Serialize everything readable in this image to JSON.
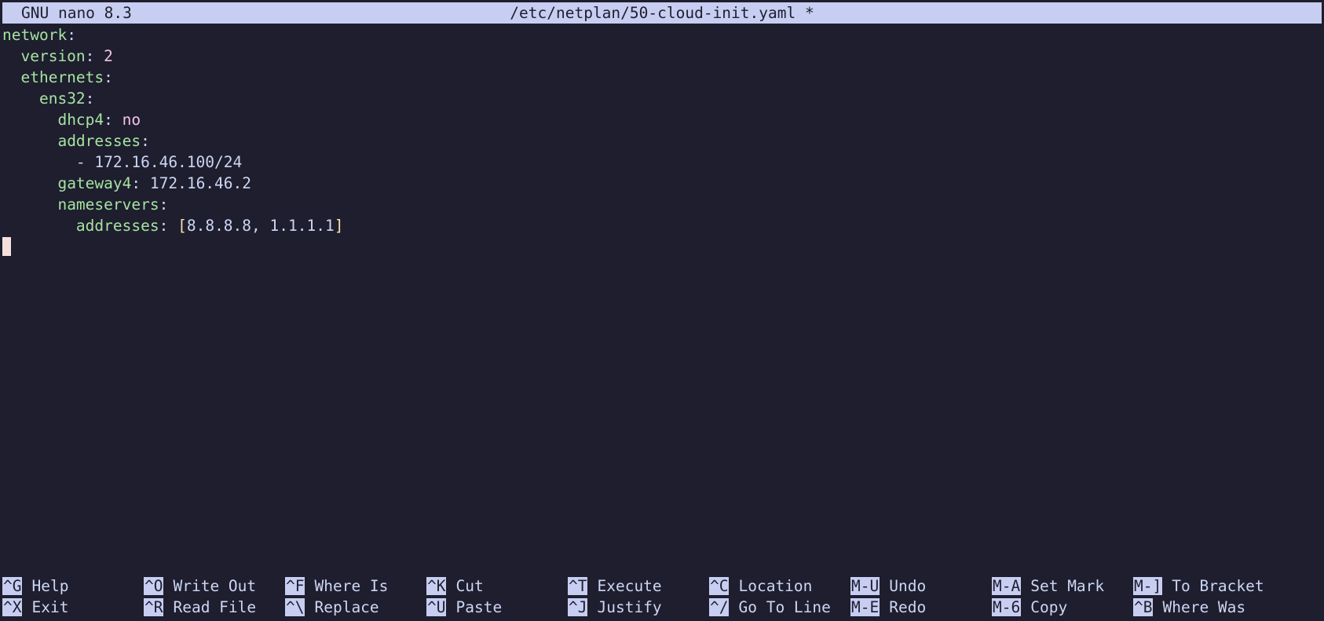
{
  "titlebar": {
    "app": "GNU nano 8.3",
    "file": "/etc/netplan/50-cloud-init.yaml *"
  },
  "editor": {
    "lines": [
      {
        "indent": "",
        "key": "network",
        "sep": ":",
        "value": "",
        "vtype": ""
      },
      {
        "indent": "  ",
        "key": "version",
        "sep": ":",
        "value": " 2",
        "vtype": "num"
      },
      {
        "indent": "  ",
        "key": "ethernets",
        "sep": ":",
        "value": "",
        "vtype": ""
      },
      {
        "indent": "    ",
        "key": "ens32",
        "sep": ":",
        "value": "",
        "vtype": ""
      },
      {
        "indent": "      ",
        "key": "dhcp4",
        "sep": ":",
        "value": " no",
        "vtype": "bool"
      },
      {
        "indent": "      ",
        "key": "addresses",
        "sep": ":",
        "value": "",
        "vtype": ""
      },
      {
        "indent": "        ",
        "key": "",
        "sep": "",
        "value": "- 172.16.46.100/24",
        "vtype": "str"
      },
      {
        "indent": "      ",
        "key": "gateway4",
        "sep": ":",
        "value": " 172.16.46.2",
        "vtype": "str"
      },
      {
        "indent": "      ",
        "key": "nameservers",
        "sep": ":",
        "value": "",
        "vtype": ""
      },
      {
        "indent": "        ",
        "key": "addresses",
        "sep": ":",
        "value": "",
        "vtype": "",
        "open_bracket": "[",
        "list": "8.8.8.8, 1.1.1.1",
        "close_bracket": "]"
      }
    ]
  },
  "shortcuts": [
    [
      {
        "key": "^G",
        "label": "Help"
      },
      {
        "key": "^O",
        "label": "Write Out"
      },
      {
        "key": "^F",
        "label": "Where Is"
      },
      {
        "key": "^K",
        "label": "Cut"
      },
      {
        "key": "^T",
        "label": "Execute"
      },
      {
        "key": "^C",
        "label": "Location"
      },
      {
        "key": "M-U",
        "label": "Undo"
      },
      {
        "key": "M-A",
        "label": "Set Mark"
      },
      {
        "key": "M-]",
        "label": "To Bracket"
      }
    ],
    [
      {
        "key": "^X",
        "label": "Exit"
      },
      {
        "key": "^R",
        "label": "Read File"
      },
      {
        "key": "^\\",
        "label": "Replace"
      },
      {
        "key": "^U",
        "label": "Paste"
      },
      {
        "key": "^J",
        "label": "Justify"
      },
      {
        "key": "^/",
        "label": "Go To Line"
      },
      {
        "key": "M-E",
        "label": "Redo"
      },
      {
        "key": "M-6",
        "label": "Copy"
      },
      {
        "key": "^B",
        "label": "Where Was"
      }
    ]
  ]
}
